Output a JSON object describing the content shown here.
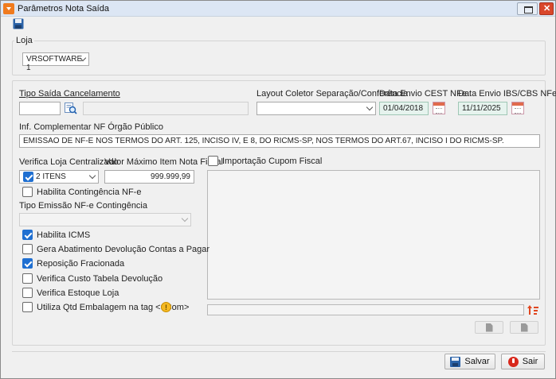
{
  "window": {
    "title": "Parâmetros Nota Saída",
    "app_icon": "chevron-down-icon",
    "controls": [
      "restore-icon",
      "close-icon"
    ]
  },
  "toolbar": {
    "save_icon": "floppy-disk-icon"
  },
  "loja": {
    "legend": "Loja",
    "selected": "VRSOFTWARE 1"
  },
  "form": {
    "tipo_saida_cancelamento_label": "Tipo Saída Cancelamento",
    "tipo_saida_code": "",
    "tipo_saida_desc": "",
    "layout_coletor_label": "Layout Coletor Separação/Conferência",
    "layout_coletor_value": "",
    "data_envio_cest_label": "Data Envio CEST NFe",
    "data_envio_cest_value": "01/04/2018",
    "data_envio_ibs_label": "Data Envio IBS/CBS NFe",
    "data_envio_ibs_value": "11/11/2025",
    "inf_complementar_label": "Inf. Complementar NF Órgão Público",
    "inf_complementar_value": "EMISSAO DE NF-E NOS TERMOS DO ART. 125, INCISO IV, E 8, DO RICMS-SP, NOS TERMOS DO ART.67, INCISO I DO RICMS-SP.",
    "verifica_loja_label": "Verifica Loja Centralizado",
    "verifica_loja_value": "2 ITENS",
    "valor_maximo_label": "Valor Máximo Item Nota Fiscal",
    "valor_maximo_value": "999.999,99",
    "importacao_cupom_label": "Importação Cupom Fiscal",
    "habilita_contingencia_label": "Habilita Contingência NF-e",
    "tipo_emissao_label": "Tipo Emissão NF-e Contingência",
    "tipo_emissao_value": ""
  },
  "checkboxes": [
    {
      "label": "Habilita ICMS",
      "checked": true
    },
    {
      "label": "Gera Abatimento Devolução Contas a Pagar",
      "checked": false
    },
    {
      "label": "Reposição Fracionada",
      "checked": true
    },
    {
      "label": "Verifica Custo Tabela Devolução",
      "checked": false
    },
    {
      "label": "Verifica Estoque Loja",
      "checked": false
    },
    {
      "label": "Utiliza Qtd Embalagem na tag <uCom>",
      "checked": false
    }
  ],
  "info_icon_text": "!",
  "footer": {
    "save_label": "Salvar",
    "exit_label": "Sair"
  },
  "colors": {
    "accent": "#1f6fd1",
    "date_field": "#e6f3ee",
    "exit_red": "#d8281c",
    "title_orange": "#f07b1f"
  }
}
